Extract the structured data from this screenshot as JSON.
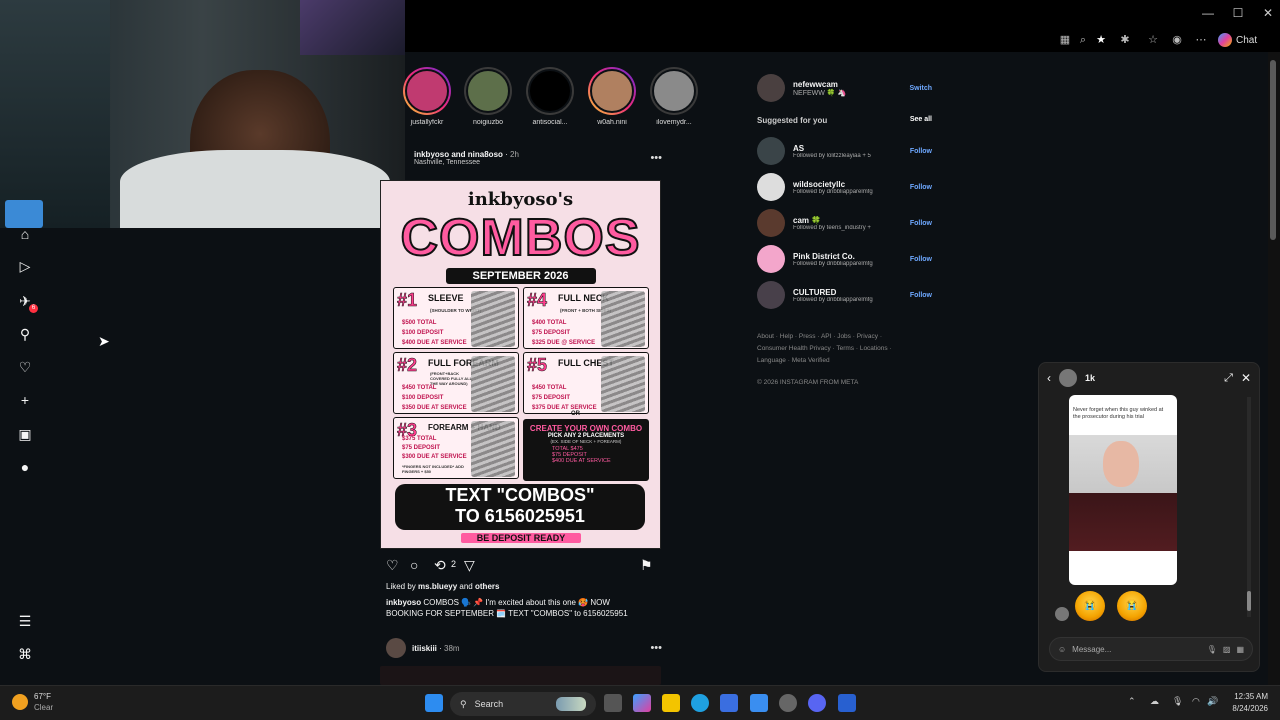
{
  "browser": {
    "window_controls": [
      "—",
      "☐",
      "✕"
    ],
    "toolbar_icons": [
      "grid-icon",
      "zoom-icon",
      "star-icon",
      "extension-icon",
      "favorites-icon",
      "profile-icon",
      "more-icon"
    ],
    "chat_label": "Chat"
  },
  "nav": {
    "items": [
      "home-icon",
      "reels-icon",
      "messages-icon",
      "search-icon",
      "notifications-icon",
      "create-icon",
      "dashboard-icon",
      "profile-icon"
    ],
    "messages_badge": "6",
    "bottom": [
      "menu-icon",
      "meta-icon"
    ]
  },
  "stories": [
    {
      "name": "justallyfckr",
      "seen": false
    },
    {
      "name": "noigiuzbo",
      "seen": true
    },
    {
      "name": "antisocial...",
      "seen": true
    },
    {
      "name": "w0ah.nini",
      "seen": false
    },
    {
      "name": "ilovemydr...",
      "seen": true
    }
  ],
  "post": {
    "authors": "inkbyoso and nina8oso",
    "time": "2h",
    "location": "Nashville, Tennessee",
    "poster": {
      "title": "inkbyoso's",
      "combos": "COMBOS",
      "month": "SEPTEMBER 2026",
      "cells": [
        {
          "num": "#1",
          "name": "SLEEVE",
          "note": "(SHOULDER TO WRIST)",
          "total": "$500 TOTAL",
          "deposit": "$100 DEPOSIT",
          "due": "$400 DUE AT SERVICE"
        },
        {
          "num": "#4",
          "name": "FULL NECK",
          "note": "(FRONT + BOTH SIDES)",
          "total": "$400 TOTAL",
          "deposit": "$75 DEPOSIT",
          "due": "$325 DUE @ SERVICE"
        },
        {
          "num": "#2",
          "name": "FULL FOREARM",
          "note": "(FRONT+BACK COVERED FULLY ALL THE WAY AROUND)",
          "total": "$450 TOTAL",
          "deposit": "$100 DEPOSIT",
          "due": "$350 DUE AT SERVICE"
        },
        {
          "num": "#5",
          "name": "FULL CHEST",
          "note": "",
          "total": "$450 TOTAL",
          "deposit": "$75 DEPOSIT",
          "due": "$375 DUE AT SERVICE"
        },
        {
          "num": "#3",
          "name": "FOREARM + HAND",
          "note": "*FINGERS NOT INCLUDED* ADD FINGERS + $50",
          "total": "$375 TOTAL",
          "deposit": "$75 DEPOSIT",
          "due": "$300 DUE AT SERVICE"
        }
      ],
      "or_label": "OR",
      "own_combo": {
        "title": "CREATE YOUR OWN COMBO",
        "sub": "PICK ANY 2 PLACEMENTS",
        "ex": "(EX. SIDE OF NECK + FOREARM)",
        "total": "TOTAL $475",
        "deposit": "$75 DEPOSIT",
        "due": "$400 DUE AT SERVICE"
      },
      "text_line1": "TEXT \"COMBOS\"",
      "text_line2": "TO 6156025951",
      "deposit_ready": "BE DEPOSIT READY"
    },
    "repost_count": "2",
    "liked_by": "Liked by",
    "liked_user": "ms.blueyy",
    "liked_and": "and",
    "liked_others": "others",
    "caption_user": "inkbyoso",
    "caption_text": "COMBOS 🗣️ 📌 I'm excited about this one 🥵 NOW BOOKING FOR SEPTEMBER 🗓️ TEXT \"COMBOS\" to 6156025951"
  },
  "next_post": {
    "user": "itiiskiii",
    "time": "38m"
  },
  "account": {
    "username": "nefewwcam",
    "display": "NEFEWW 🍀 🦄",
    "switch": "Switch"
  },
  "suggested": {
    "title": "Suggested for you",
    "see_all": "See all",
    "items": [
      {
        "name": "AS",
        "sub": "Followed by lolitzzleayiaa + 5",
        "action": "Follow"
      },
      {
        "name": "wildsocietyllc",
        "sub": "Followed by dribbliapparelmfg",
        "action": "Follow"
      },
      {
        "name": "cam 🍀",
        "sub": "Followed by teens_industry +",
        "action": "Follow"
      },
      {
        "name": "Pink District Co.",
        "sub": "Followed by dribbliapparelmfg",
        "action": "Follow"
      },
      {
        "name": "CULTURED",
        "sub": "Followed by dribbliapparelmfg",
        "action": "Follow"
      }
    ]
  },
  "footer": {
    "links1": "About · Help · Press · API · Jobs · Privacy ·",
    "links2": "Consumer Health Privacy · Terms · Locations ·",
    "links3": "Language · Meta Verified",
    "copyright": "© 2026 INSTAGRAM FROM META"
  },
  "chat": {
    "name": "1k",
    "media_caption": "Never forget when this guy winked at the prosecutor during his trial",
    "placeholder": "Message..."
  },
  "taskbar": {
    "weather_temp": "67°F",
    "weather_desc": "Clear",
    "search_label": "Search",
    "time": "12:35 AM",
    "date": "8/24/2026"
  },
  "colors": {
    "bg": "#0c1014",
    "link": "#6ea8ff",
    "badge": "#ff3040",
    "poster_pink": "#ff5ba0"
  }
}
